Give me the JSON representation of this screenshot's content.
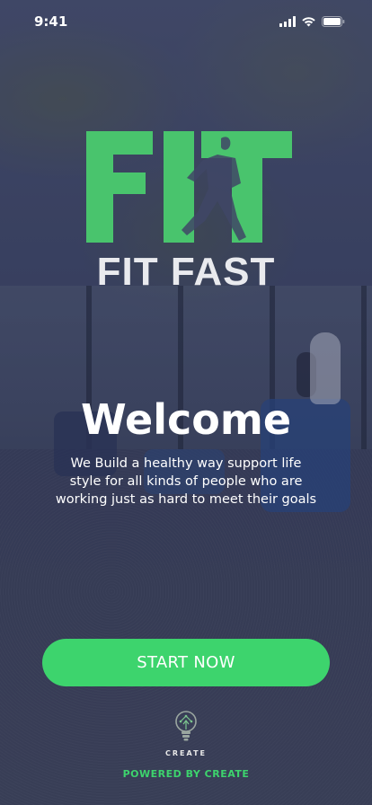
{
  "status_bar": {
    "time": "9:41",
    "icons": [
      "signal-icon",
      "wifi-icon",
      "battery-icon"
    ]
  },
  "brand": {
    "logo_letters": "FIT",
    "name": "FIT FAST",
    "accent_color": "#3dd46d"
  },
  "hero": {
    "title": "Welcome",
    "tagline": "We Build a healthy way support life style for all kinds of people who are working just as hard to meet their goals"
  },
  "cta": {
    "label": "START NOW"
  },
  "footer": {
    "logo_text": "CREATE",
    "logo_icon": "lightbulb-icon",
    "powered_by": "POWERED BY CREATE"
  }
}
